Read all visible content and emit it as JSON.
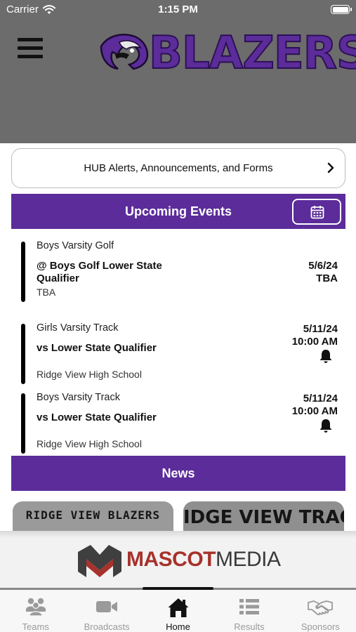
{
  "status_bar": {
    "carrier": "Carrier",
    "time": "1:15 PM",
    "battery_level": 1.0
  },
  "header": {
    "brand_name": "BLAZERS"
  },
  "alerts": {
    "label": "HUB Alerts, Announcements, and Forms"
  },
  "events": {
    "title": "Upcoming Events",
    "items": [
      {
        "sport": "Boys Varsity Golf",
        "title": "@ Boys Golf Lower State Qualifier",
        "location": "TBA",
        "date": "5/6/24",
        "time": "TBA",
        "has_bell": false
      },
      {
        "sport": "Girls Varsity Track",
        "title": "vs Lower State Qualifier",
        "location": "Ridge View High School",
        "date": "5/11/24",
        "time": "10:00 AM",
        "has_bell": true
      },
      {
        "sport": "Boys Varsity Track",
        "title": "vs Lower State Qualifier",
        "location": "Ridge View High School",
        "date": "5/11/24",
        "time": "10:00 AM",
        "has_bell": true
      }
    ]
  },
  "news": {
    "title": "News",
    "cards": [
      {
        "text": "RIDGE VIEW BLAZERS"
      },
      {
        "text": "IDGE VIEW TRAC"
      }
    ]
  },
  "sponsor": {
    "brand_bold": "MASCOT",
    "brand_regular": "MEDIA"
  },
  "tabs": [
    {
      "label": "Teams",
      "icon": "teams-icon",
      "active": false
    },
    {
      "label": "Broadcasts",
      "icon": "video-camera-icon",
      "active": false
    },
    {
      "label": "Home",
      "icon": "home-icon",
      "active": true
    },
    {
      "label": "Results",
      "icon": "list-icon",
      "active": false
    },
    {
      "label": "Sponsors",
      "icon": "handshake-icon",
      "active": false
    }
  ],
  "colors": {
    "accent": "#5b2c9a",
    "header_bg": "#6c6c6c",
    "sponsor_red": "#a6322b"
  }
}
